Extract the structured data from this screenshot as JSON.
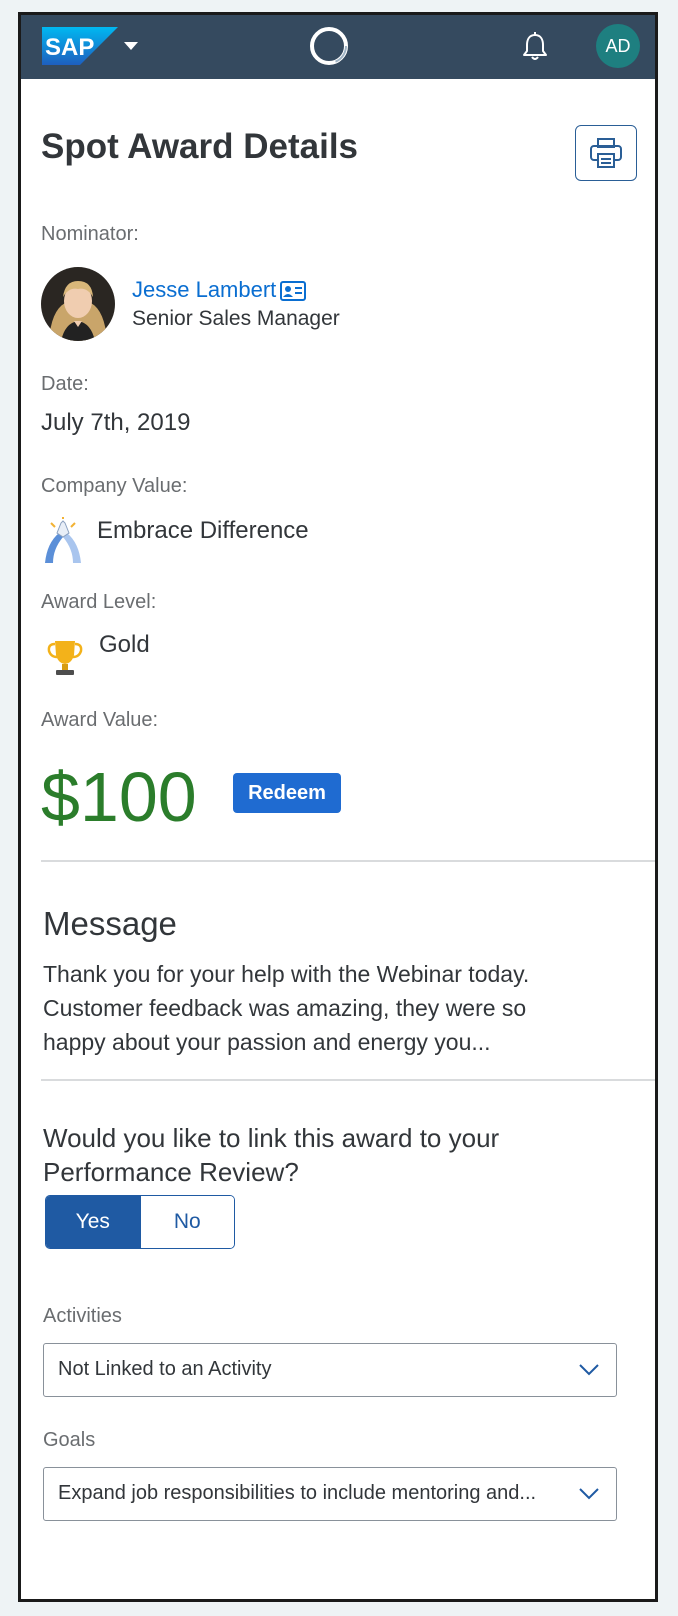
{
  "shell": {
    "logo_text": "SAP",
    "user_initials": "AD",
    "colors": {
      "shellbar": "#354a5f",
      "avatar": "#1e7f80"
    }
  },
  "page": {
    "title": "Spot Award Details"
  },
  "nominator": {
    "label": "Nominator:",
    "name": "Jesse Lambert",
    "role": "Senior Sales Manager"
  },
  "date": {
    "label": "Date:",
    "value": "July 7th, 2019"
  },
  "company_value": {
    "label": "Company Value:",
    "value": "Embrace Difference",
    "icon": "high-five-icon"
  },
  "award_level": {
    "label": "Award Level:",
    "value": "Gold",
    "icon": "trophy-icon"
  },
  "award_value": {
    "label": "Award Value:",
    "value": "$100",
    "redeem_label": "Redeem",
    "value_color": "#2b7d2b"
  },
  "message": {
    "heading": "Message",
    "lines": [
      "Thank you for your help with the Webinar today.",
      "Customer feedback was amazing, they were so",
      "happy about your passion and energy you..."
    ]
  },
  "performance_review": {
    "question_lines": [
      "Would you like to link this award to your",
      "Performance Review?"
    ],
    "options": [
      "Yes",
      "No"
    ],
    "selected": "Yes"
  },
  "activities": {
    "label": "Activities",
    "selected": "Not Linked to an Activity"
  },
  "goals": {
    "label": "Goals",
    "selected": "Expand job responsibilities to include mentoring and..."
  }
}
